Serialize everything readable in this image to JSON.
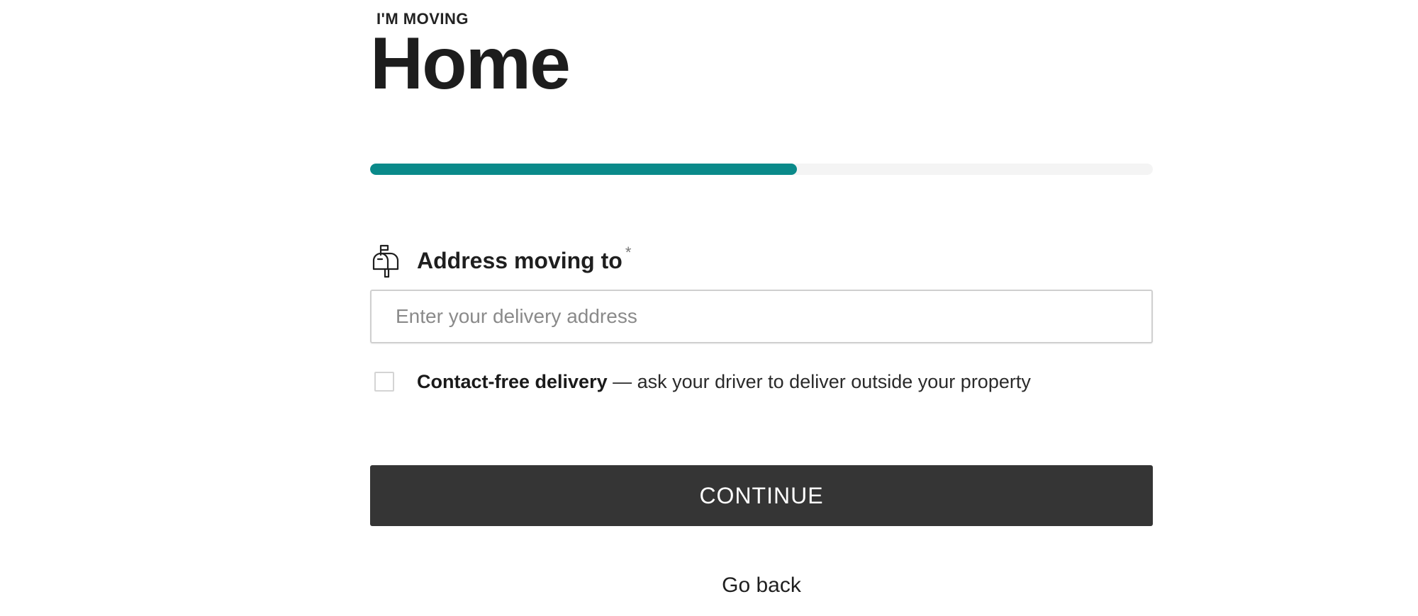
{
  "header": {
    "eyebrow": "I'M MOVING",
    "title": "Home"
  },
  "progress": {
    "value_percent": 54.5,
    "fill_color": "#0A8A8A",
    "track_color": "#F4F4F4"
  },
  "address_field": {
    "icon": "mailbox-icon",
    "label": "Address moving to",
    "required_mark": "*",
    "placeholder": "Enter your delivery address",
    "value": ""
  },
  "contact_free": {
    "checked": false,
    "bold_label": "Contact-free delivery",
    "description": " — ask your driver to deliver outside your property"
  },
  "actions": {
    "continue_label": "CONTINUE",
    "continue_color": "#353535",
    "go_back_label": "Go back"
  }
}
